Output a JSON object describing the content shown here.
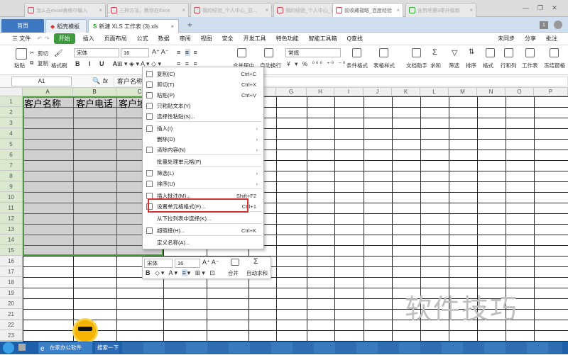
{
  "browser_tabs": [
    {
      "label": "怎么在excel表格中输入"
    },
    {
      "label": "三种方法，教你在Exce"
    },
    {
      "label": "我的经验_个人中心_百..."
    },
    {
      "label": "我的经验_个人中心_百..."
    },
    {
      "label": "前收藏福略_百度经验",
      "active": true
    },
    {
      "label": "含剪吧第3季升级新"
    }
  ],
  "doc_tabs": {
    "home": "首页",
    "template": "稻壳模板",
    "file": "新建 XLS 工作表 (3).xls",
    "add": "+",
    "page_num": "1"
  },
  "menu": {
    "file": "三 文件",
    "items": [
      "开始",
      "插入",
      "页面布局",
      "公式",
      "数据",
      "审阅",
      "视图",
      "安全",
      "开发工具",
      "特色功能",
      "智能工具箱"
    ],
    "search": "Q查找",
    "right": [
      "未同步",
      "分享",
      "批注"
    ]
  },
  "ribbon": {
    "paste": "粘贴",
    "cut": "剪切",
    "copy": "复制",
    "format_painter": "格式刷",
    "font": "宋体",
    "size": "16",
    "merge": "合并居中",
    "wrap": "自动换行",
    "number_format": "常规",
    "cond_format": "条件格式",
    "table_style": "表格样式",
    "doc_helper": "文档助手",
    "sum": "求和",
    "filter": "筛选",
    "sort": "排序",
    "format": "格式",
    "row_col": "行和列",
    "worksheet": "工作表",
    "freeze": "冻结窗格"
  },
  "formula_bar": {
    "name_box": "A1",
    "fx": "fx",
    "content": "客户名称"
  },
  "columns": [
    "A",
    "B",
    "C",
    "D",
    "E",
    "F",
    "G",
    "H",
    "I",
    "J",
    "K",
    "L",
    "M",
    "N",
    "O",
    "P"
  ],
  "rows": [
    "1",
    "2",
    "3",
    "4",
    "5",
    "6",
    "7",
    "8",
    "9",
    "10",
    "11",
    "12",
    "13",
    "14",
    "15",
    "16",
    "17",
    "18",
    "19",
    "20",
    "21",
    "22",
    "23"
  ],
  "cells": {
    "a1": "客户名称",
    "b1": "客户电话",
    "c1": "客户地"
  },
  "context_menu": [
    {
      "label": "复制(C)",
      "key": "Ctrl+C",
      "icon": "copy-icon"
    },
    {
      "label": "剪切(T)",
      "key": "Ctrl+X",
      "icon": "scissors-icon"
    },
    {
      "label": "粘贴(P)",
      "key": "Ctrl+V",
      "icon": "paste-icon"
    },
    {
      "label": "只粘贴文本(Y)",
      "icon": "paste-text-icon"
    },
    {
      "label": "选择性粘贴(S)...",
      "icon": "paste-special-icon"
    },
    {
      "label": "插入(I)",
      "submenu": true,
      "icon": "insert-icon"
    },
    {
      "label": "删除(D)",
      "submenu": true
    },
    {
      "label": "清除内容(N)",
      "submenu": true,
      "icon": "eraser-icon"
    },
    {
      "label": "批量处理单元格(P)"
    },
    {
      "label": "筛选(L)",
      "submenu": true,
      "icon": "filter-icon"
    },
    {
      "label": "排序(U)",
      "submenu": true,
      "icon": "sort-icon"
    },
    {
      "label": "插入批注(M)...",
      "key": "Shift+F2",
      "icon": "comment-icon"
    },
    {
      "label": "设置单元格格式(F)...",
      "key": "Ctrl+1",
      "icon": "format-cells-icon"
    },
    {
      "label": "从下拉列表中选择(K)..."
    },
    {
      "label": "超链接(H)...",
      "key": "Ctrl+K",
      "icon": "link-icon"
    },
    {
      "label": "定义名称(A)..."
    }
  ],
  "mini_toolbar": {
    "font": "宋体",
    "size": "16",
    "merge": "合并",
    "autosum": "自动求和"
  },
  "taskbar": {
    "app1": "在家办公软件",
    "app2": "搜索一下"
  },
  "watermark": "软件技巧"
}
